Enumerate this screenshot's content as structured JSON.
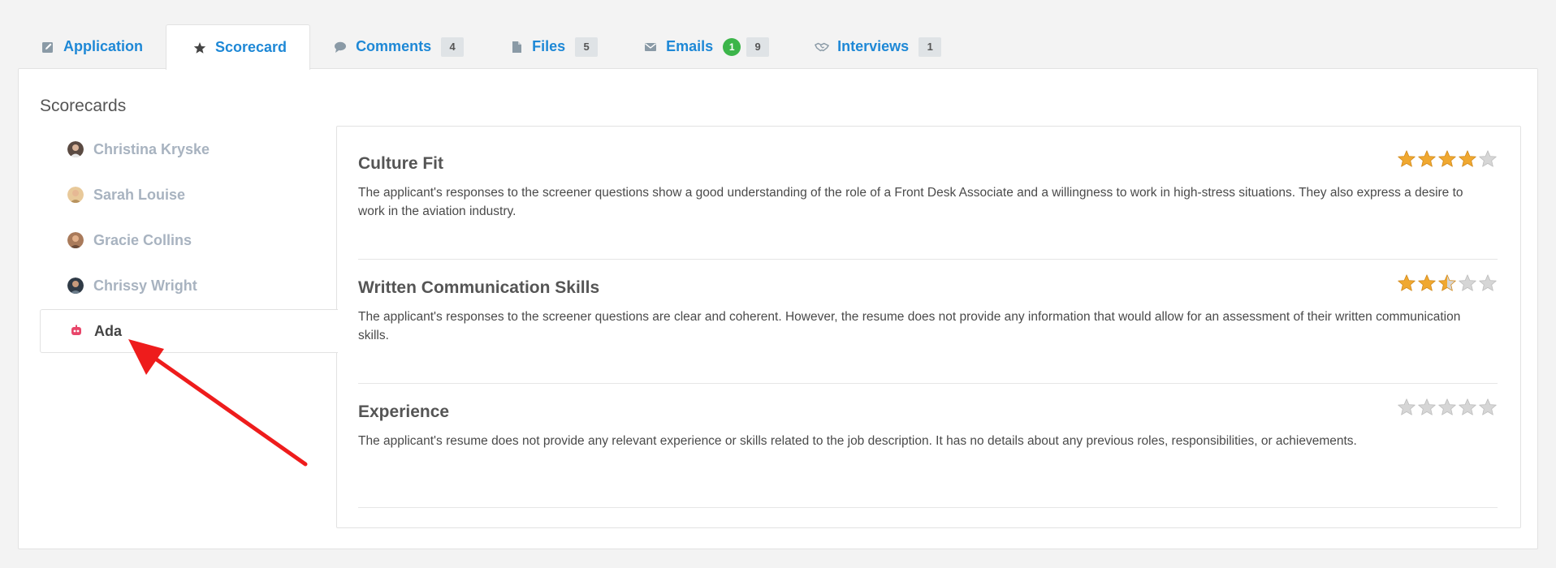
{
  "tabs": [
    {
      "label": "Application",
      "icon": "edit-icon",
      "active": false
    },
    {
      "label": "Scorecard",
      "icon": "star-icon",
      "active": true
    },
    {
      "label": "Comments",
      "icon": "comment-icon",
      "count": "4"
    },
    {
      "label": "Files",
      "icon": "file-icon",
      "count": "5"
    },
    {
      "label": "Emails",
      "icon": "envelope-icon",
      "new_count": "1",
      "count": "9"
    },
    {
      "label": "Interviews",
      "icon": "handshake-icon",
      "count": "1"
    }
  ],
  "panel": {
    "title": "Scorecards"
  },
  "reviewers": [
    {
      "name": "Christina Kryske",
      "active": false
    },
    {
      "name": "Sarah Louise",
      "active": false
    },
    {
      "name": "Gracie Collins",
      "active": false
    },
    {
      "name": "Chrissy Wright",
      "active": false
    },
    {
      "name": "Ada",
      "active": true
    }
  ],
  "criteria": [
    {
      "title": "Culture Fit",
      "rating": 4,
      "text": "The applicant's responses to the screener questions show a good understanding of the role of a Front Desk Associate and a willingness to work in high-stress situations. They also express a desire to work in the aviation industry."
    },
    {
      "title": "Written Communication Skills",
      "rating": 2.5,
      "text": "The applicant's responses to the screener questions are clear and coherent. However, the resume does not provide any information that would allow for an assessment of their written communication skills."
    },
    {
      "title": "Experience",
      "rating": 0,
      "text": "The applicant's resume does not provide any relevant experience or skills related to the job description. It has no details about any previous roles, responsibilities, or achievements."
    }
  ],
  "colors": {
    "link": "#1e88d6",
    "star_filled": "#f0a830",
    "star_empty": "#d6d6d6",
    "badge_green": "#3cb54a",
    "arrow": "#ee1c1c"
  }
}
